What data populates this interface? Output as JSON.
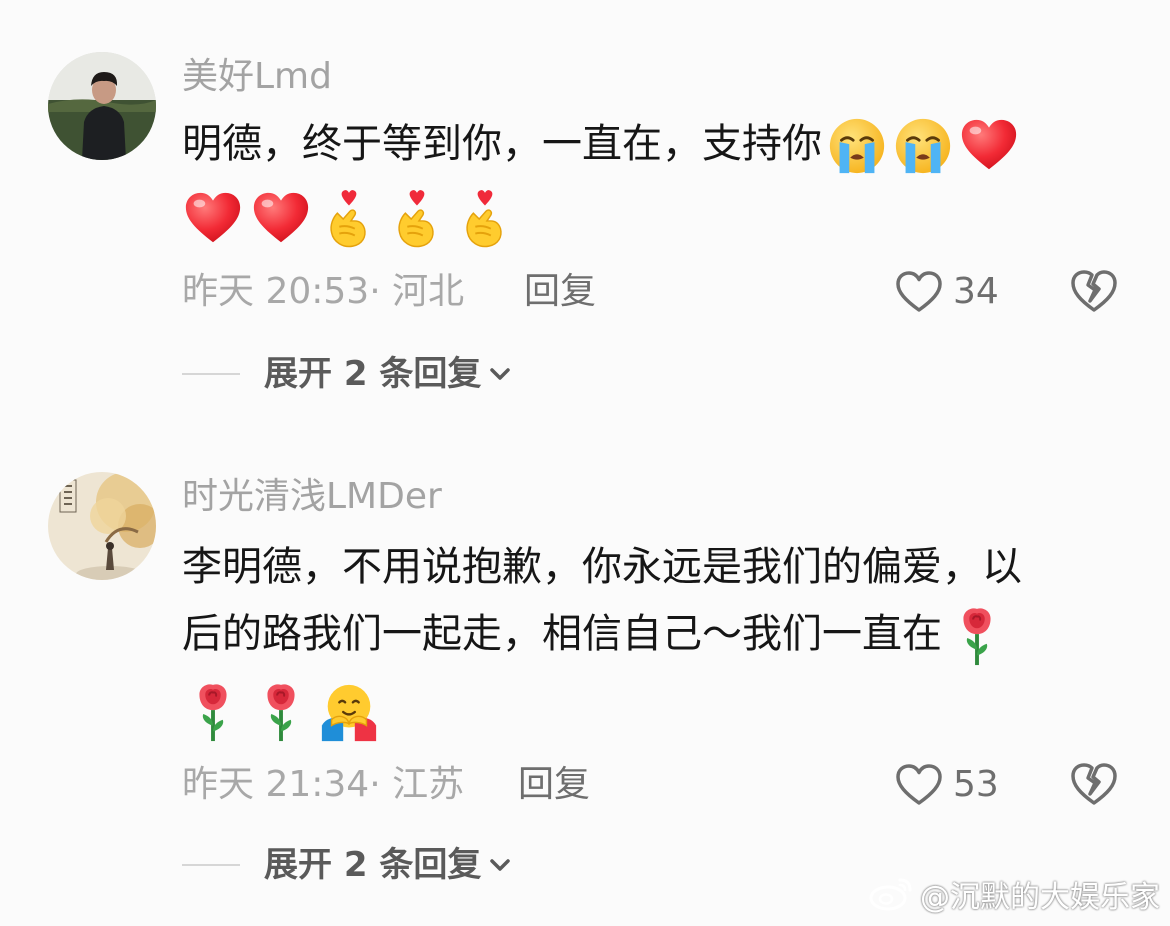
{
  "comments": [
    {
      "username": "美好Lmd",
      "text": "明德，终于等到你，一直在，支持你",
      "inline_emojis": [
        "crying-face-icon",
        "crying-face-icon",
        "red-heart-icon"
      ],
      "emoji_row": [
        "red-heart-icon",
        "red-heart-icon",
        "finger-heart-icon",
        "finger-heart-icon",
        "finger-heart-icon"
      ],
      "time": "昨天 20:53",
      "location": "河北",
      "meta_separator": "·",
      "reply_label": "回复",
      "like_count": "34",
      "expand_label": "展开 2 条回复"
    },
    {
      "username": "时光清浅LMDer",
      "text_line1": "李明德，不用说抱歉，你永远是我们的偏爱，以",
      "text_line2": "后的路我们一起走，相信自己～我们一直在",
      "inline_emojis": [
        "rose-icon"
      ],
      "emoji_row": [
        "rose-icon",
        "rose-icon",
        "hugging-face-icon"
      ],
      "time": "昨天 21:34",
      "location": "江苏",
      "meta_separator": "·",
      "reply_label": "回复",
      "like_count": "53",
      "expand_label": "展开 2 条回复"
    }
  ],
  "watermark": "@沉默的大娱乐家",
  "colors": {
    "background": "#fbfbfb",
    "username": "#a3a3a3",
    "text": "#161616",
    "meta": "#a8a8a8",
    "action": "#6e6e6e"
  }
}
